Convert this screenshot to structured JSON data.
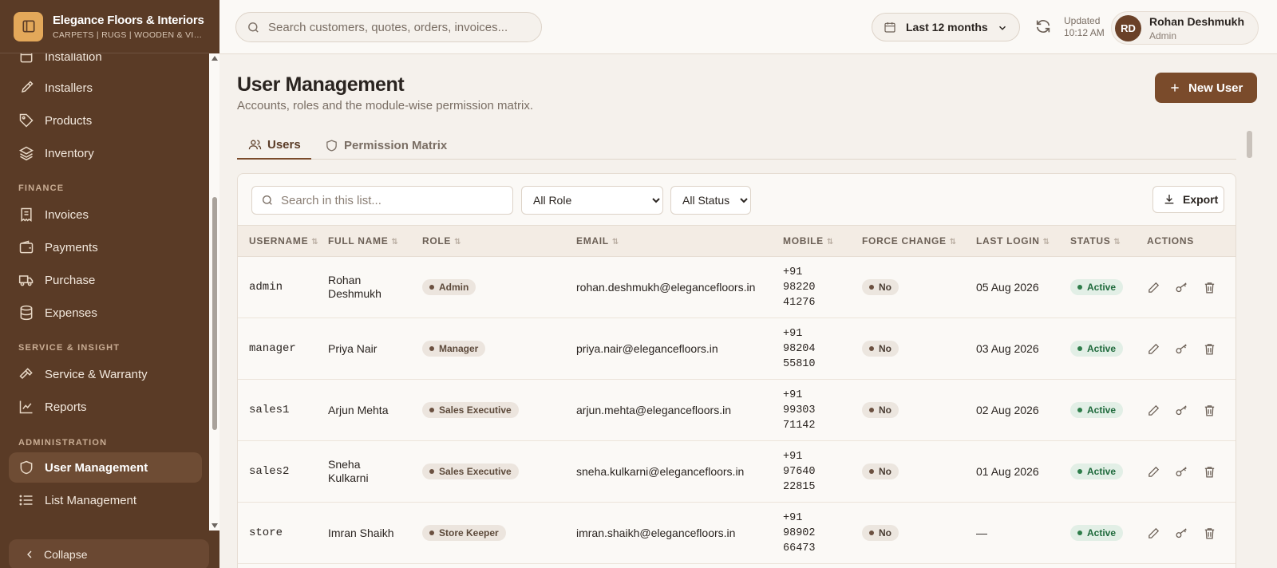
{
  "brand": {
    "name": "Elegance Floors & Interiors",
    "tagline": "CARPETS | RUGS | WOODEN & VINYL"
  },
  "sidebar": {
    "items": [
      {
        "label": "Installation",
        "icon": "square-icon"
      },
      {
        "label": "Installers",
        "icon": "brush-icon"
      },
      {
        "label": "Products",
        "icon": "tag-icon"
      },
      {
        "label": "Inventory",
        "icon": "layers-icon"
      },
      {
        "label": "Invoices",
        "icon": "receipt-icon"
      },
      {
        "label": "Payments",
        "icon": "wallet-icon"
      },
      {
        "label": "Purchase",
        "icon": "truck-icon"
      },
      {
        "label": "Expenses",
        "icon": "database-icon"
      },
      {
        "label": "Service & Warranty",
        "icon": "hammer-icon"
      },
      {
        "label": "Reports",
        "icon": "chart-line-icon"
      },
      {
        "label": "User Management",
        "icon": "shield-icon",
        "active": true
      },
      {
        "label": "List Management",
        "icon": "list-icon"
      }
    ],
    "sections": {
      "finance": "FINANCE",
      "service": "SERVICE & INSIGHT",
      "admin": "ADMINISTRATION"
    },
    "collapse_label": "Collapse"
  },
  "topbar": {
    "search_placeholder": "Search customers, quotes, orders, invoices...",
    "period": "Last 12 months",
    "updated_label": "Updated",
    "updated_time": "10:12 AM",
    "user": {
      "initials": "RD",
      "name": "Rohan Deshmukh",
      "role": "Admin"
    }
  },
  "page": {
    "title": "User Management",
    "subtitle": "Accounts, roles and the module-wise permission matrix.",
    "new_user_label": "New User",
    "tabs": [
      {
        "label": "Users",
        "icon": "users-icon",
        "active": true
      },
      {
        "label": "Permission Matrix",
        "icon": "shield-icon",
        "active": false
      }
    ]
  },
  "filters": {
    "search_placeholder": "Search in this list...",
    "role_selected": "All Role",
    "status_selected": "All Status",
    "export_label": "Export"
  },
  "table": {
    "columns": [
      "USERNAME",
      "FULL NAME",
      "ROLE",
      "EMAIL",
      "MOBILE",
      "FORCE CHANGE",
      "LAST LOGIN",
      "STATUS",
      "ACTIONS"
    ],
    "rows": [
      {
        "username": "admin",
        "full_name": "Rohan Deshmukh",
        "role": "Admin",
        "email": "rohan.deshmukh@elegancefloors.in",
        "mobile": "+91 98220 41276",
        "force_change": "No",
        "last_login": "05 Aug 2026",
        "status": "Active"
      },
      {
        "username": "manager",
        "full_name": "Priya Nair",
        "role": "Manager",
        "email": "priya.nair@elegancefloors.in",
        "mobile": "+91 98204 55810",
        "force_change": "No",
        "last_login": "03 Aug 2026",
        "status": "Active"
      },
      {
        "username": "sales1",
        "full_name": "Arjun Mehta",
        "role": "Sales Executive",
        "email": "arjun.mehta@elegancefloors.in",
        "mobile": "+91 99303 71142",
        "force_change": "No",
        "last_login": "02 Aug 2026",
        "status": "Active"
      },
      {
        "username": "sales2",
        "full_name": "Sneha Kulkarni",
        "role": "Sales Executive",
        "email": "sneha.kulkarni@elegancefloors.in",
        "mobile": "+91 97640 22815",
        "force_change": "No",
        "last_login": "01 Aug 2026",
        "status": "Active"
      },
      {
        "username": "store",
        "full_name": "Imran Shaikh",
        "role": "Store Keeper",
        "email": "imran.shaikh@elegancefloors.in",
        "mobile": "+91 98902 66473",
        "force_change": "No",
        "last_login": "—",
        "status": "Active"
      }
    ]
  }
}
